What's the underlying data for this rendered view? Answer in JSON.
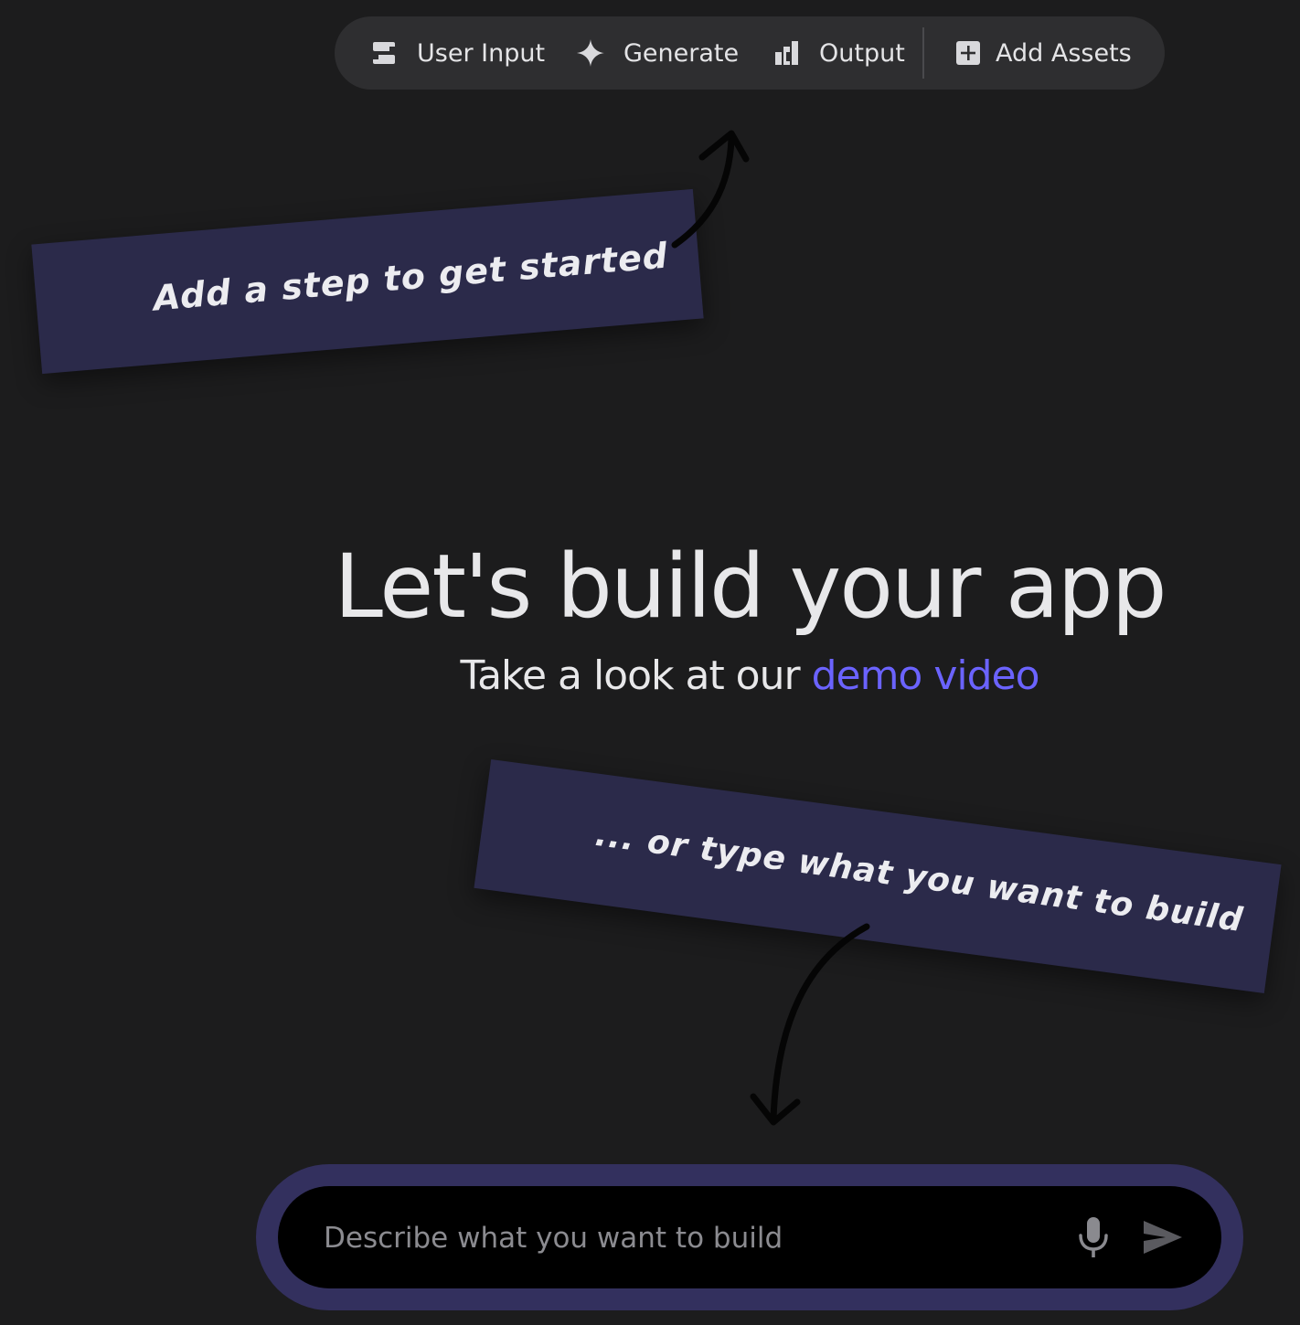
{
  "toolbar": {
    "items": [
      {
        "label": "User Input",
        "icon": "user-input-icon"
      },
      {
        "label": "Generate",
        "icon": "sparkle-icon"
      },
      {
        "label": "Output",
        "icon": "output-chart-icon"
      },
      {
        "label": "Add Assets",
        "icon": "add-box-icon"
      }
    ]
  },
  "notes": {
    "top": "Add a step to get started",
    "bottom": "... or type what you want to build"
  },
  "hero": {
    "title": "Let's build your app",
    "subtitle_prefix": "Take a look at our ",
    "subtitle_link": "demo video"
  },
  "prompt": {
    "placeholder": "Describe what you want to build",
    "value": ""
  },
  "colors": {
    "background": "#1c1c1d",
    "toolbar": "#2e2e30",
    "note": "#2b2a4a",
    "link": "#6b63ff",
    "prompt_ring": "#33305e"
  }
}
